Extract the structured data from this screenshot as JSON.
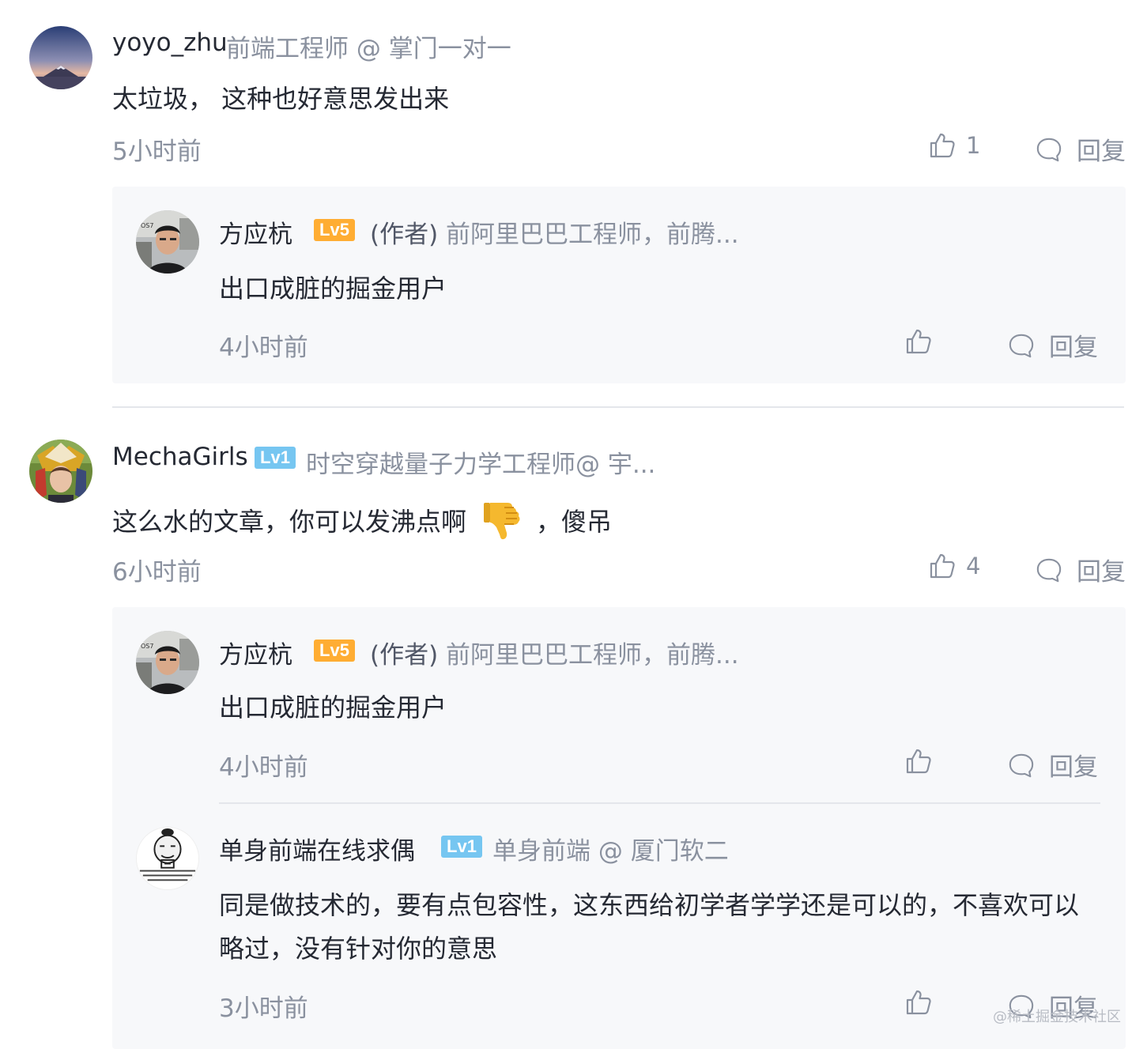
{
  "comments": [
    {
      "user": "yoyo_zhu",
      "title": "前端工程师 @ 掌门一对一",
      "content": "太垃圾， 这种也好意思发出来",
      "time": "5小时前",
      "likes": "1",
      "reply_label": "回复",
      "replies": [
        {
          "user": "方应杭",
          "level": "Lv5",
          "author_tag": "(作者)",
          "title": "前阿里巴巴工程师，前腾...",
          "content": "出口成脏的掘金用户",
          "time": "4小时前",
          "reply_label": "回复"
        }
      ]
    },
    {
      "user": "MechaGirls",
      "level": "Lv1",
      "title": "时空穿越量子力学工程师@ 宇...",
      "content_before": "这么水的文章，你可以发沸点啊",
      "content_emoji": "thumbs-down",
      "content_after": "，傻吊",
      "time": "6小时前",
      "likes": "4",
      "reply_label": "回复",
      "replies": [
        {
          "user": "方应杭",
          "level": "Lv5",
          "author_tag": "(作者)",
          "title": "前阿里巴巴工程师，前腾...",
          "content": "出口成脏的掘金用户",
          "time": "4小时前",
          "reply_label": "回复"
        },
        {
          "user": "单身前端在线求偶",
          "level": "Lv1",
          "title": "单身前端 @ 厦门软二",
          "content_line1": "同是做技术的，要有点包容性，这东西给初学者学学还是可以的，不喜欢可以",
          "content_line2": "略过，没有针对你的意思",
          "time": "3小时前",
          "reply_label": "回复"
        }
      ]
    }
  ],
  "watermark": "@稀土掘金技术社区",
  "icons": {
    "like": "thumbs-up-icon",
    "reply": "comment-bubble-icon"
  },
  "colors": {
    "lv5": "#ffad33",
    "lv1": "#76c6f1",
    "muted": "#8a919f",
    "text": "#252933",
    "reply_bg": "#f7f8fa"
  }
}
